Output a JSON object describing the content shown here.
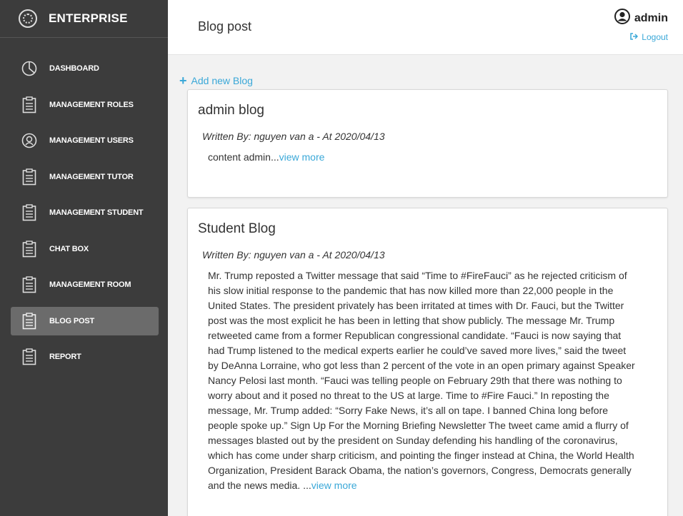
{
  "brand": {
    "name": "ENTERPRISE"
  },
  "sidebar": {
    "items": [
      {
        "label": "DASHBOARD",
        "icon": "pie-chart-icon"
      },
      {
        "label": "MANAGEMENT ROLES",
        "icon": "clipboard-icon"
      },
      {
        "label": "MANAGEMENT USERS",
        "icon": "user-circle-icon"
      },
      {
        "label": "MANAGEMENT TUTOR",
        "icon": "clipboard-icon"
      },
      {
        "label": "MANAGEMENT STUDENT",
        "icon": "clipboard-icon"
      },
      {
        "label": "CHAT BOX",
        "icon": "clipboard-icon"
      },
      {
        "label": "MANAGEMENT ROOM",
        "icon": "clipboard-icon"
      },
      {
        "label": "BLOG POST",
        "icon": "clipboard-icon",
        "active": true
      },
      {
        "label": "REPORT",
        "icon": "clipboard-icon"
      }
    ]
  },
  "header": {
    "title": "Blog post",
    "user": "admin",
    "logout_label": "Logout"
  },
  "content": {
    "add_label": "Add new Blog",
    "posts": [
      {
        "title": "admin blog",
        "meta": "Written By: nguyen van a - At 2020/04/13",
        "body": "content admin...",
        "view_more": "view more"
      },
      {
        "title": "Student Blog",
        "meta": "Written By: nguyen van a - At 2020/04/13",
        "body": "Mr. Trump reposted a Twitter message that said “Time to #FireFauci” as he rejected criticism of his slow initial response to the pandemic that has now killed more than 22,000 people in the United States. The president privately has been irritated at times with Dr. Fauci, but the Twitter post was the most explicit he has been in letting that show publicly. The message Mr. Trump retweeted came from a former Republican congressional candidate. “Fauci is now saying that had Trump listened to the medical experts earlier he could’ve saved more lives,” said the tweet by DeAnna Lorraine, who got less than 2 percent of the vote in an open primary against Speaker Nancy Pelosi last month. “Fauci was telling people on February 29th that there was nothing to worry about and it posed no threat to the US at large. Time to #Fire Fauci.” In reposting the message, Mr. Trump added: “Sorry Fake News, it’s all on tape. I banned China long before people spoke up.” Sign Up For the Morning Briefing Newsletter The tweet came amid a flurry of messages blasted out by the president on Sunday defending his handling of the coronavirus, which has come under sharp criticism, and pointing the finger instead at China, the World Health Organization, President Barack Obama, the nation’s governors, Congress, Democrats generally and the news media. ...",
        "view_more": "view more"
      }
    ]
  },
  "colors": {
    "sidebar": "#3c3c3c",
    "active": "#6b6b6b",
    "accent": "#3aa8d8"
  }
}
